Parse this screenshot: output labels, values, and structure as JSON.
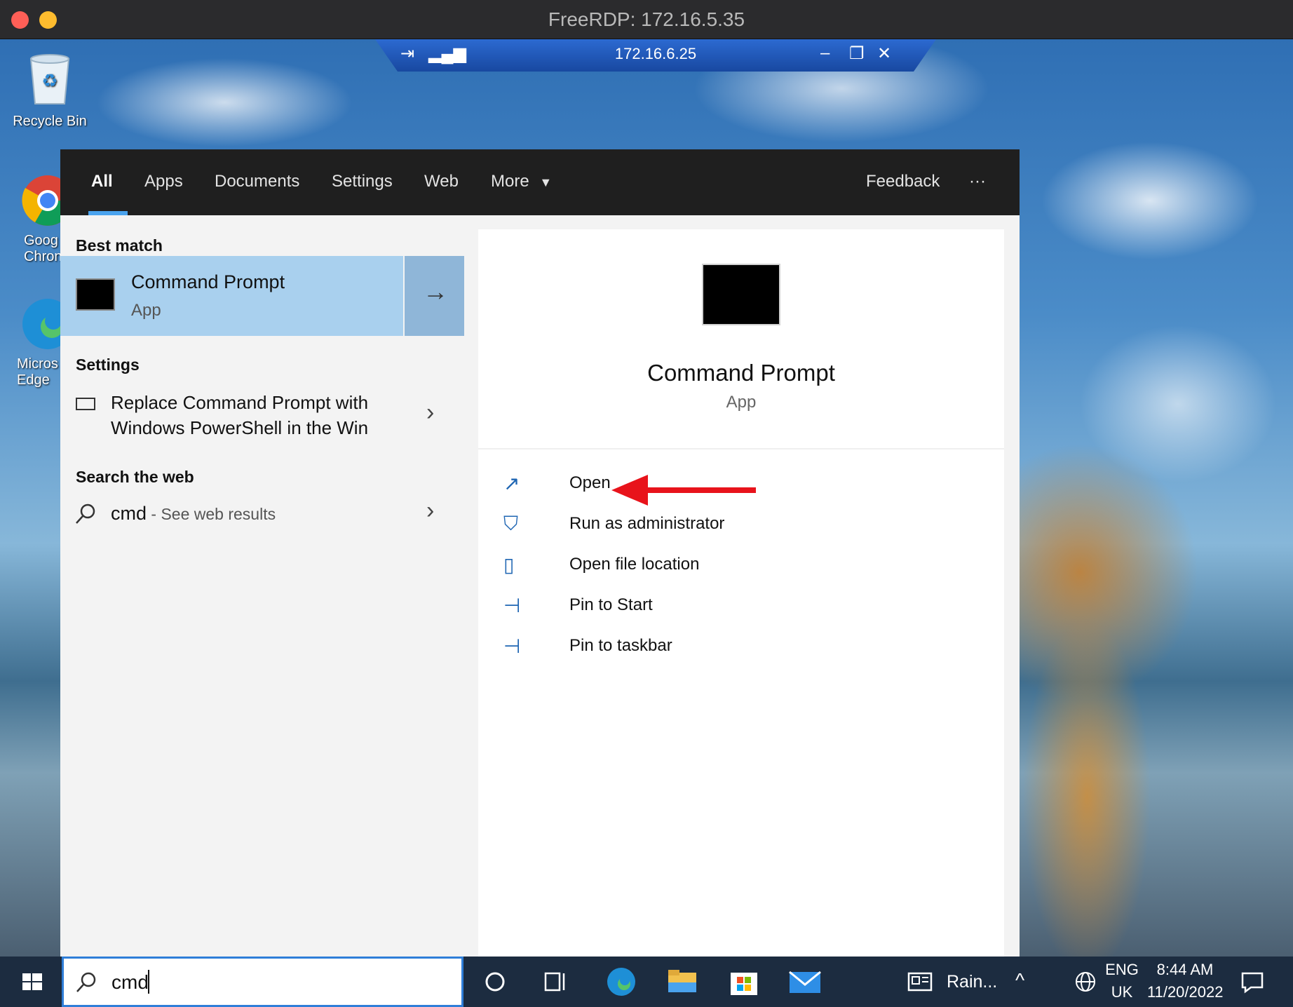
{
  "window": {
    "title": "FreeRDP: 172.16.5.35"
  },
  "rdp_bar": {
    "host": "172.16.6.25"
  },
  "desktop_icons": [
    {
      "label": "Recycle Bin"
    },
    {
      "label": "Goog\nChron"
    },
    {
      "label": "Micros\nEdge"
    }
  ],
  "tabs": {
    "all": "All",
    "apps": "Apps",
    "documents": "Documents",
    "settings": "Settings",
    "web": "Web",
    "more": "More",
    "feedback": "Feedback",
    "overflow": "···"
  },
  "left": {
    "best_match_heading": "Best match",
    "best_match": {
      "title": "Command Prompt",
      "subtitle": "App"
    },
    "settings_heading": "Settings",
    "settings_item_line1": "Replace Command Prompt with",
    "settings_item_line2": "Windows PowerShell in the Win",
    "web_heading": "Search the web",
    "web_query": "cmd",
    "web_suffix": " - See web results"
  },
  "right": {
    "title": "Command Prompt",
    "subtitle": "App",
    "actions": [
      {
        "label": "Open"
      },
      {
        "label": "Run as administrator"
      },
      {
        "label": "Open file location"
      },
      {
        "label": "Pin to Start"
      },
      {
        "label": "Pin to taskbar"
      }
    ]
  },
  "annotation": {
    "color": "#e8131b",
    "points_to": "Open"
  },
  "taskbar": {
    "search_value": "cmd",
    "news": "Rain...",
    "lang_top": "ENG",
    "lang_bottom": "UK",
    "time": "8:44 AM",
    "date": "11/20/2022"
  }
}
